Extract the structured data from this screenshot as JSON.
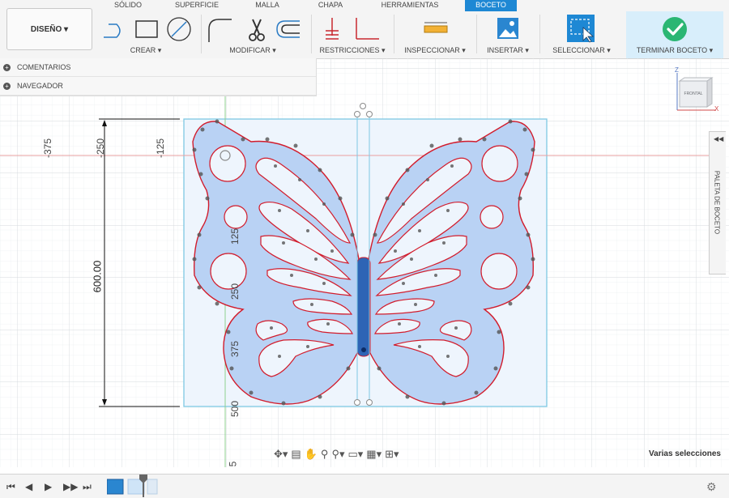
{
  "tabs": [
    {
      "label": "SÓLIDO",
      "active": false
    },
    {
      "label": "SUPERFICIE",
      "active": false
    },
    {
      "label": "MALLA",
      "active": false
    },
    {
      "label": "CHAPA",
      "active": false
    },
    {
      "label": "HERRAMIENTAS",
      "active": false
    },
    {
      "label": "BOCETO",
      "active": true
    }
  ],
  "workspace_button": {
    "label": "DISEÑO ▾"
  },
  "groups": {
    "crear": "CREAR ▾",
    "modificar": "MODIFICAR ▾",
    "restricciones": "RESTRICCIONES ▾",
    "inspeccionar": "INSPECCIONAR ▾",
    "insertar": "INSERTAR ▾",
    "seleccionar": "SELECCIONAR ▾",
    "terminar": "TERMINAR BOCETO ▾"
  },
  "browser": {
    "comments": "COMENTARIOS",
    "navigator": "NAVEGADOR"
  },
  "ruler_labels": {
    "h_neg375": "-375",
    "h_neg250": "-250",
    "h_neg125": "-125",
    "v_125": "125",
    "v_250": "250",
    "v_375": "375",
    "v_500": "500",
    "v_625": "5"
  },
  "dimension": {
    "value": "600.00"
  },
  "viewcube": {
    "face": "FRONTAL",
    "axis_z": "Z",
    "axis_x": "X"
  },
  "palette": {
    "label": "PALETA DE BOCETO"
  },
  "status": {
    "text": "Varias selecciones"
  },
  "colors": {
    "accent": "#1e88d4",
    "sketch_fill": "#b9d2f4",
    "profile_line": "#d21c2c",
    "bounding_box": "#7ec8e3",
    "finish_check": "#2bb673",
    "grid_minor": "#eceff2",
    "grid_major": "#d5dade"
  }
}
